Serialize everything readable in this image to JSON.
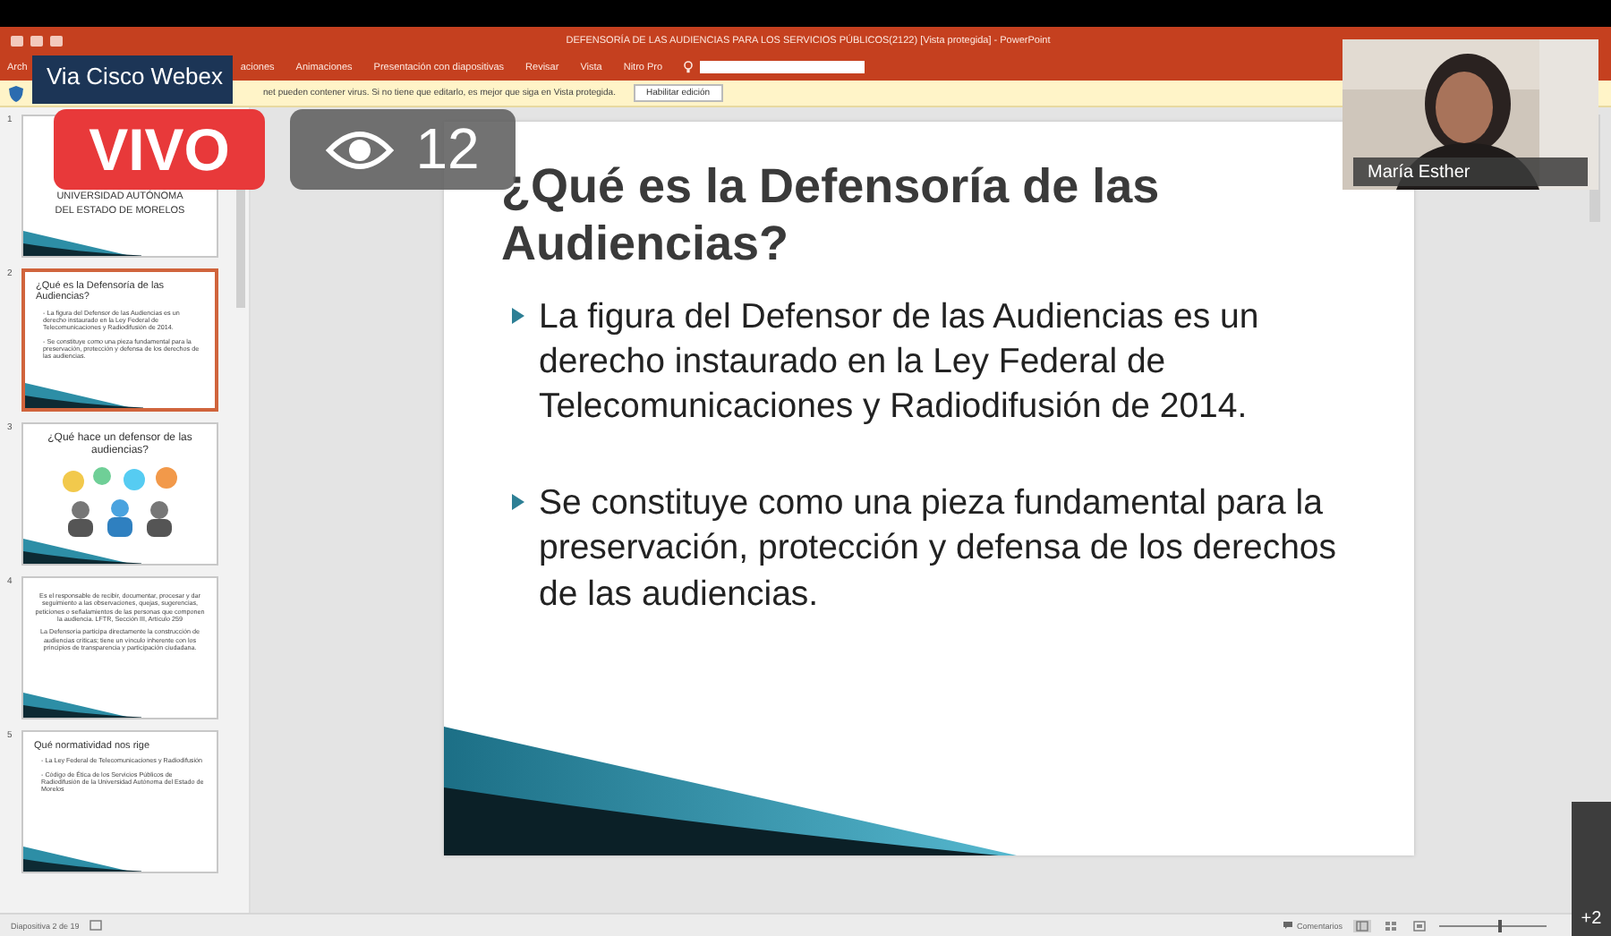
{
  "window": {
    "title": "DEFENSORÍA DE LAS AUDIENCIAS PARA LOS SERVICIOS PÚBLICOS(2122) [Vista protegida] - PowerPoint"
  },
  "ribbon_tabs": [
    "Arch",
    "aciones",
    "Animaciones",
    "Presentación con diapositivas",
    "Revisar",
    "Vista",
    "Nitro Pro"
  ],
  "protected_view": {
    "message": "net pueden contener virus. Si no tiene que editarlo, es mejor que siga en Vista protegida.",
    "button": "Habilitar edición"
  },
  "thumbnails": [
    {
      "number": "1",
      "selected": false,
      "kind": "title",
      "lines": [
        "UNIVERSIDAD AUTÓNOMA",
        "DEL ESTADO DE MORELOS"
      ]
    },
    {
      "number": "2",
      "selected": true,
      "kind": "bullets",
      "title": "¿Qué es la Defensoría de las Audiencias?",
      "lines": [
        "- La figura del Defensor de las Audiencias es un derecho instaurado en la Ley Federal de Telecomunicaciones y Radiodifusión de 2014.",
        "- Se constituye como una pieza fundamental para la preservación, protección y defensa de los derechos de las audiencias."
      ]
    },
    {
      "number": "3",
      "selected": false,
      "kind": "picture",
      "title": "¿Qué hace un defensor de las audiencias?"
    },
    {
      "number": "4",
      "selected": false,
      "kind": "centered",
      "lines": [
        "Es el responsable de recibir, documentar, procesar y dar seguimiento a las observaciones, quejas, sugerencias, peticiones o señalamientos de las personas que componen la audiencia. LFTR, Sección III, Artículo 259",
        "La Defensoría participa directamente la construcción de audiencias críticas; tiene un vínculo inherente con los principios de transparencia y participación ciudadana."
      ]
    },
    {
      "number": "5",
      "selected": false,
      "kind": "bullets",
      "title": "Qué normatividad nos rige",
      "lines": [
        "- La Ley Federal de Telecomunicaciones y Radiodifusión",
        "- Código de Ética de los Servicios Públicos de Radiodifusión de la Universidad Autónoma del Estado de Morelos"
      ]
    }
  ],
  "slide": {
    "title": "¿Qué es la Defensoría de las Audiencias?",
    "bullets": [
      "La figura del Defensor de las Audiencias es un derecho instaurado en la Ley Federal de Telecomunicaciones y Radiodifusión de 2014.",
      "Se constituye como una pieza fundamental para la preservación, protección y defensa de los derechos de las audiencias."
    ]
  },
  "status_bar": {
    "slide_counter": "Diapositiva 2 de 19",
    "comments": "Comentarios",
    "zoom": {
      "level": 0.55
    }
  },
  "overlay": {
    "brand": "Via Cisco Webex",
    "live_badge": "VIVO",
    "viewers": "12",
    "participant": {
      "name": "María Esther",
      "kind": "picture"
    },
    "extra_participants": "+2"
  }
}
